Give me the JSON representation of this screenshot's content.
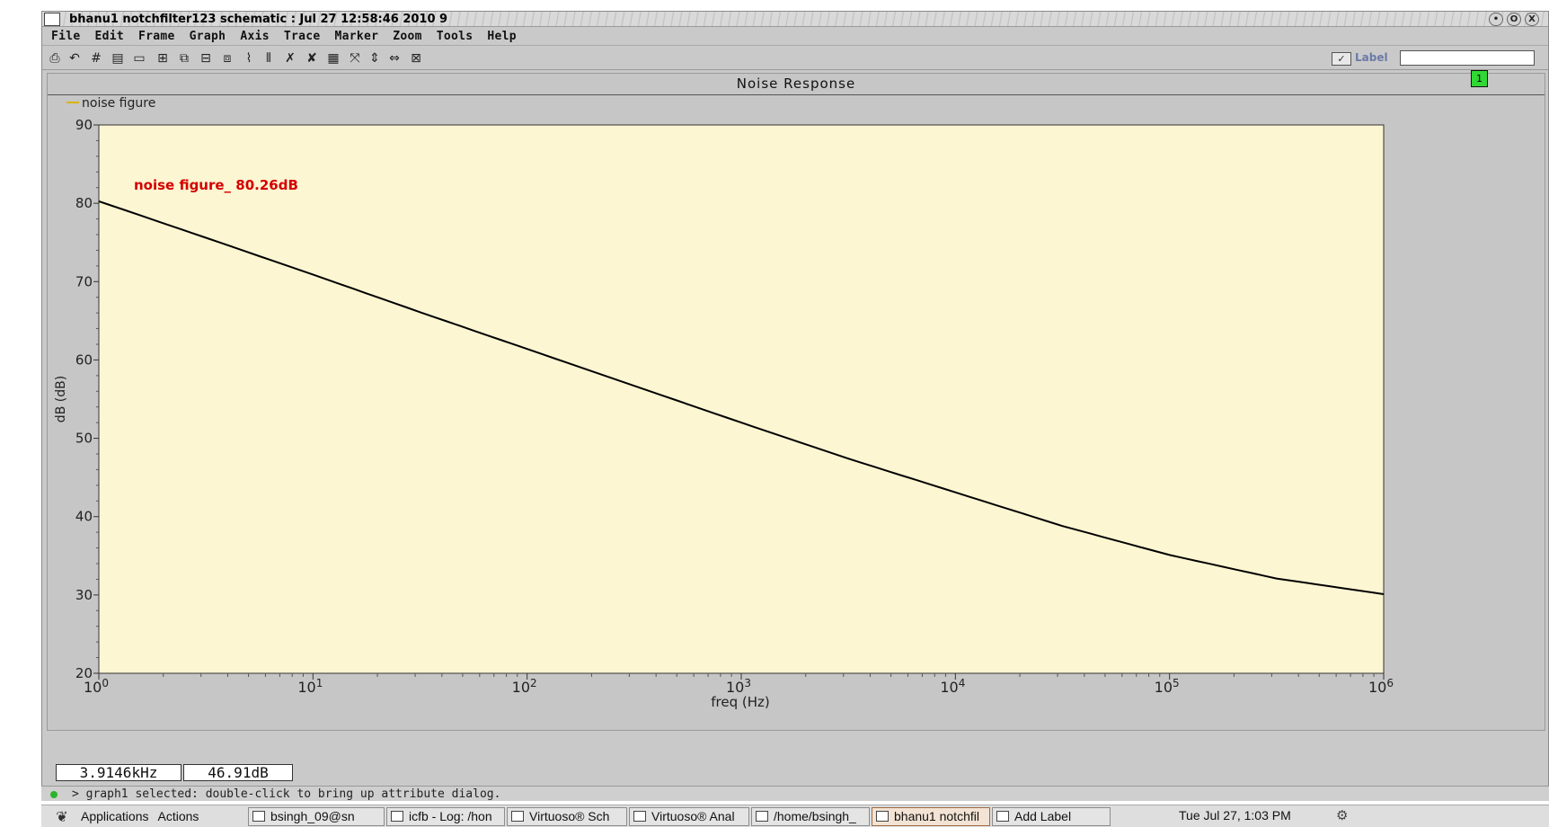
{
  "window": {
    "title": "bhanu1 notchfilter123 schematic : Jul 27 12:58:46 2010 9",
    "controls": [
      "•",
      "O",
      "X"
    ]
  },
  "menu": [
    "File",
    "Edit",
    "Frame",
    "Graph",
    "Axis",
    "Trace",
    "Marker",
    "Zoom",
    "Tools",
    "Help"
  ],
  "toolbar": {
    "icons": [
      "print-icon",
      "undo-icon",
      "grid-icon",
      "strip-icon",
      "frame-icon",
      "layout-icon",
      "copy-icon",
      "clone-icon",
      "overlay-icon",
      "marker-icon",
      "bars-icon",
      "cross-icon",
      "cross2-icon",
      "table-icon",
      "fit-icon",
      "vzoom-icon",
      "hzoom-icon",
      "zoom-fit-icon"
    ],
    "label_text": "Label",
    "label_check": "✓",
    "label_value": ""
  },
  "graph": {
    "badge": "1"
  },
  "chart_data": {
    "type": "line",
    "title": "Noise Response",
    "xlabel": "freq (Hz)",
    "ylabel": "dB (dB)",
    "x_scale": "log",
    "xlim": [
      1,
      1000000
    ],
    "ylim": [
      20,
      90
    ],
    "y_ticks": [
      20,
      30,
      40,
      50,
      60,
      70,
      80,
      90
    ],
    "x_ticks": [
      {
        "base": "10",
        "exp": "0"
      },
      {
        "base": "10",
        "exp": "1"
      },
      {
        "base": "10",
        "exp": "2"
      },
      {
        "base": "10",
        "exp": "3"
      },
      {
        "base": "10",
        "exp": "4"
      },
      {
        "base": "10",
        "exp": "5"
      },
      {
        "base": "10",
        "exp": "6"
      }
    ],
    "series": [
      {
        "name": "noise figure",
        "color": "#000000",
        "x": [
          1,
          3.162,
          10,
          31.62,
          100,
          316.2,
          1000,
          3162,
          10000,
          31620,
          100000,
          316200,
          1000000
        ],
        "values": [
          80.26,
          75.6,
          70.9,
          66.1,
          61.4,
          56.7,
          52.0,
          47.4,
          43.1,
          38.8,
          35.1,
          32.1,
          30.1
        ]
      }
    ],
    "annotation": {
      "text": "noise figure_ 80.26dB",
      "color": "#d40000"
    },
    "background": "#fdf6d2",
    "grid": false,
    "legend": "top-left"
  },
  "cursor": {
    "x_readout": "3.9146kHz",
    "y_readout": "46.91dB"
  },
  "status": {
    "text": "> graph1 selected: double-click to bring up attribute dialog."
  },
  "taskbar": {
    "applications": "Applications",
    "actions": "Actions",
    "tasks": [
      "bsingh_09@sn",
      "icfb - Log: /hon",
      "Virtuoso® Sch",
      "Virtuoso® Anal",
      "/home/bsingh_",
      "bhanu1 notchfil",
      "Add Label"
    ],
    "clock": "Tue Jul 27,  1:03 PM"
  }
}
